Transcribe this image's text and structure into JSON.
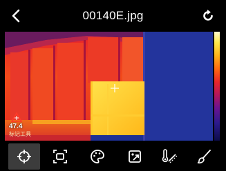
{
  "header": {
    "title": "00140E.jpg",
    "back_icon": "chevron-left-icon",
    "refresh_icon": "refresh-icon"
  },
  "measurement": {
    "hot_spot_temp": "47.4",
    "hot_spot_label": "标记工具"
  },
  "toolbar": {
    "items": [
      {
        "name": "crosshair-tool",
        "icon": "crosshair-icon",
        "active": true
      },
      {
        "name": "area-tool",
        "icon": "area-frame-icon",
        "active": false
      },
      {
        "name": "palette-tool",
        "icon": "palette-icon",
        "active": false
      },
      {
        "name": "image-tool",
        "icon": "image-edit-icon",
        "active": false
      },
      {
        "name": "emissivity-tool",
        "icon": "thermometer-icon",
        "active": false
      },
      {
        "name": "brush-tool",
        "icon": "brush-icon",
        "active": false
      }
    ]
  },
  "colors": {
    "background": "#000000",
    "cold": "#1e2f94",
    "hot": "#ffe94a",
    "active_tool": "#3c3c3c"
  }
}
